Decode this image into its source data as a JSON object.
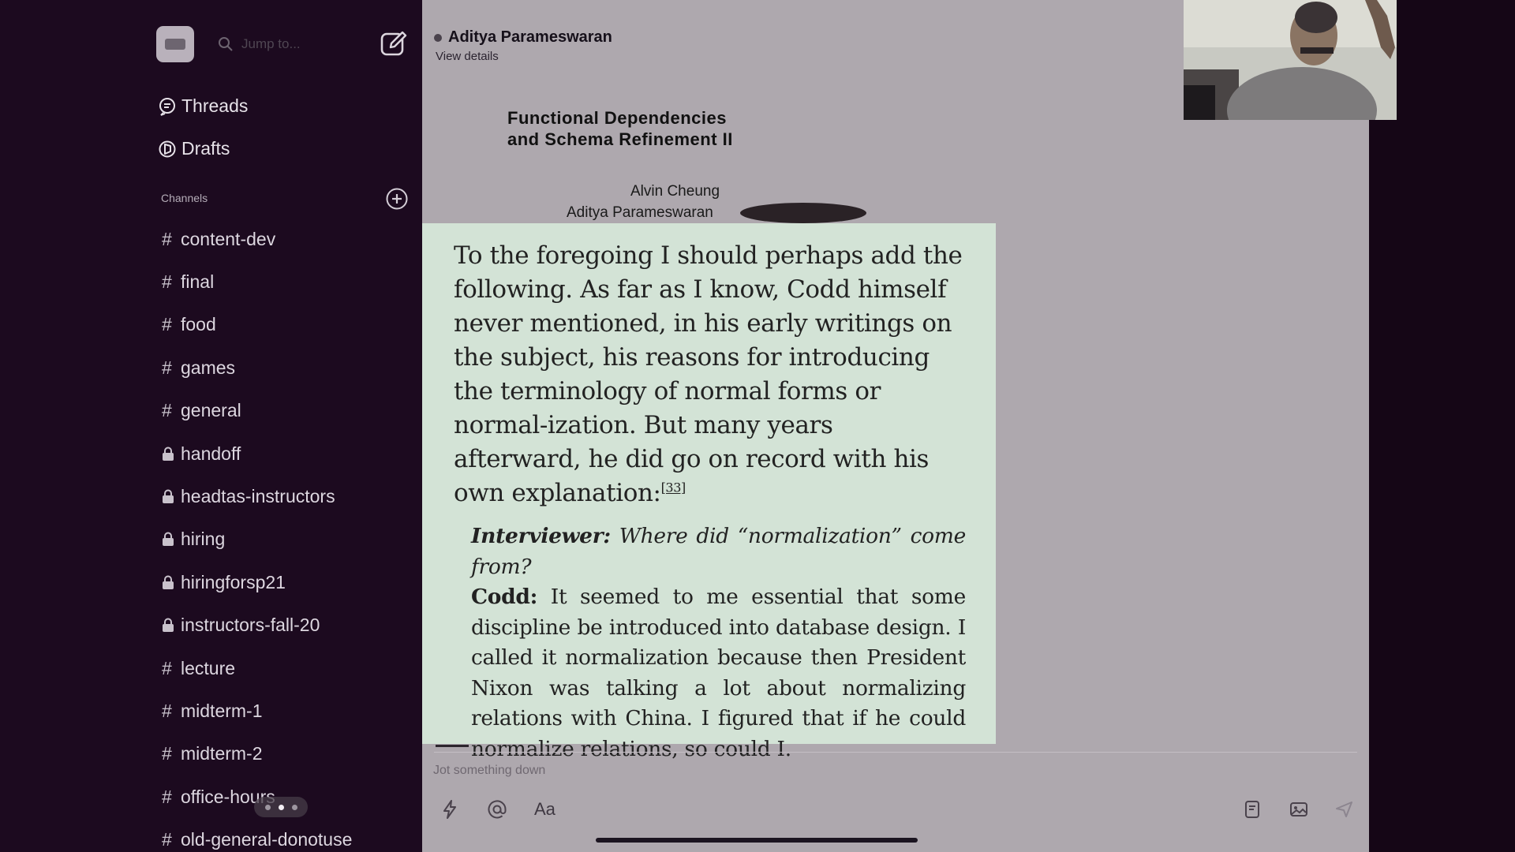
{
  "sidebar": {
    "search_placeholder": "Jump to...",
    "threads_label": "Threads",
    "drafts_label": "Drafts",
    "channels_header": "Channels",
    "channels": [
      {
        "name": "content-dev",
        "private": false
      },
      {
        "name": "final",
        "private": false
      },
      {
        "name": "food",
        "private": false
      },
      {
        "name": "games",
        "private": false
      },
      {
        "name": "general",
        "private": false
      },
      {
        "name": "handoff",
        "private": true
      },
      {
        "name": "headtas-instructors",
        "private": true
      },
      {
        "name": "hiring",
        "private": true
      },
      {
        "name": "hiringforsp21",
        "private": true
      },
      {
        "name": "instructors-fall-20",
        "private": true
      },
      {
        "name": "lecture",
        "private": false
      },
      {
        "name": "midterm-1",
        "private": false
      },
      {
        "name": "midterm-2",
        "private": false
      },
      {
        "name": "office-hours",
        "private": false
      },
      {
        "name": "old-general-donotuse",
        "private": false
      }
    ]
  },
  "conversation": {
    "name": "Aditya Parameswaran",
    "view_details": "View details"
  },
  "slide": {
    "title_line1": "Functional Dependencies",
    "title_line2": "and Schema Refinement II",
    "author1": "Alvin Cheung",
    "author2": "Aditya Parameswaran"
  },
  "quote": {
    "body": "To the foregoing I should perhaps add the following. As far as I know, Codd himself never mentioned, in his early writings on the subject, his reasons for introducing the terminology of normal forms or normal-ization. But many years afterward, he did go on record with his own explanation:",
    "footnote": "[33]",
    "interviewer_label": "Interviewer:",
    "interviewer_text": "Where did “normalization” come from?",
    "codd_label": "Codd:",
    "codd_text": "It seemed to me essential that some discipline be introduced into database design. I called it normalization because then President Nixon was talking a lot about normalizing relations with China. I figured that if he could normalize relations, so could I."
  },
  "composer": {
    "placeholder": "Jot something down",
    "format_label": "Aa"
  }
}
